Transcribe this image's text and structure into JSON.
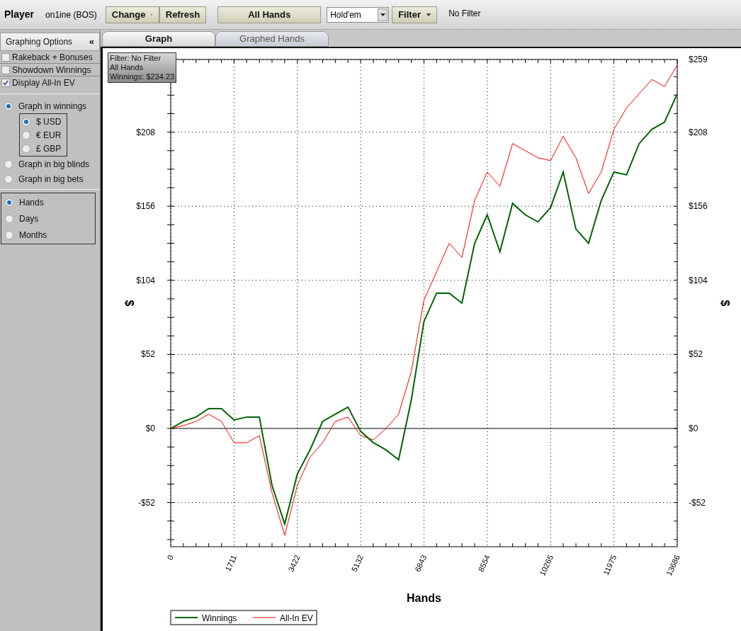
{
  "toolbar": {
    "title": "Player",
    "player": "on1ine (BOS)",
    "buttons": [
      {
        "label": "Change",
        "kind": "dropdown"
      },
      {
        "label": "Refresh",
        "kind": "plain"
      },
      {
        "label": "All Hands",
        "kind": "wide"
      }
    ],
    "game_select": {
      "value": "Hold'em"
    },
    "filter_button": {
      "label": "Filter"
    },
    "filter_status": "No Filter"
  },
  "sidebar": {
    "title": "Graphing Options",
    "collapse": "«",
    "checkboxes": [
      {
        "label": "Rakeback + Bonuses",
        "checked": false
      },
      {
        "label": "Showdown Winnings",
        "checked": false
      },
      {
        "label": "Display All-In EV",
        "checked": true
      }
    ],
    "units": [
      {
        "label": "Graph in winnings",
        "selected": true,
        "children": [
          {
            "label": "$ USD",
            "selected": true
          },
          {
            "label": "€ EUR",
            "selected": false
          },
          {
            "label": "£ GBP",
            "selected": false
          }
        ]
      },
      {
        "label": "Graph in big blinds",
        "selected": false
      },
      {
        "label": "Graph in big bets",
        "selected": false
      }
    ],
    "period": [
      {
        "label": "Hands",
        "selected": true
      },
      {
        "label": "Days",
        "selected": false
      },
      {
        "label": "Months",
        "selected": false
      }
    ]
  },
  "tabs": [
    {
      "label": "Graph",
      "selected": true
    },
    {
      "label": "Graphed Hands",
      "selected": false
    }
  ],
  "info_box": [
    "Filter: No Filter",
    "All Hands",
    "Winnings: $234.23"
  ],
  "chart": {
    "chart_data": {
      "type": "line",
      "xlabel": "Hands",
      "ylabel": "$",
      "x": [
        0,
        342,
        684,
        1026,
        1368,
        1711,
        2053,
        2395,
        2737,
        3079,
        3421,
        3763,
        4105,
        4447,
        4790,
        5132,
        5474,
        5816,
        6158,
        6500,
        6842,
        7184,
        7526,
        7868,
        8211,
        8553,
        8895,
        9237,
        9579,
        9921,
        10263,
        10605,
        10947,
        11289,
        11632,
        11974,
        12316,
        12658,
        13000,
        13342,
        13686
      ],
      "series": [
        {
          "name": "Winnings",
          "color": "#006400",
          "values": [
            0,
            5,
            8,
            14,
            14,
            6,
            8,
            8,
            -40,
            -67,
            -32,
            -15,
            5,
            10,
            15,
            -2,
            -10,
            -15,
            -22,
            20,
            75,
            95,
            95,
            88,
            130,
            150,
            124,
            158,
            150,
            145,
            155,
            180,
            140,
            130,
            160,
            180,
            178,
            200,
            210,
            215,
            235
          ]
        },
        {
          "name": "All-In EV",
          "color": "#ff0000",
          "values": [
            0,
            2,
            5,
            10,
            5,
            -10,
            -10,
            -5,
            -45,
            -75,
            -40,
            -20,
            -10,
            5,
            8,
            -5,
            -8,
            0,
            10,
            40,
            90,
            110,
            130,
            120,
            160,
            180,
            170,
            200,
            195,
            190,
            188,
            205,
            190,
            165,
            180,
            210,
            225,
            235,
            245,
            240,
            255
          ]
        }
      ],
      "grid": true,
      "legend": true,
      "xlim": [
        0,
        13686
      ],
      "ylim": [
        -83,
        259
      ],
      "xticks": [
        0,
        1711,
        3422,
        5132,
        6843,
        8554,
        10265,
        11975,
        13686
      ],
      "yticks": [
        {
          "value": -52,
          "label": "-$52"
        },
        {
          "value": 0,
          "label": "$0"
        },
        {
          "value": 52,
          "label": "$52"
        },
        {
          "value": 104,
          "label": "$104"
        },
        {
          "value": 156,
          "label": "$156"
        },
        {
          "value": 208,
          "label": "$208"
        },
        {
          "value": 259,
          "label": "$259"
        }
      ]
    }
  }
}
